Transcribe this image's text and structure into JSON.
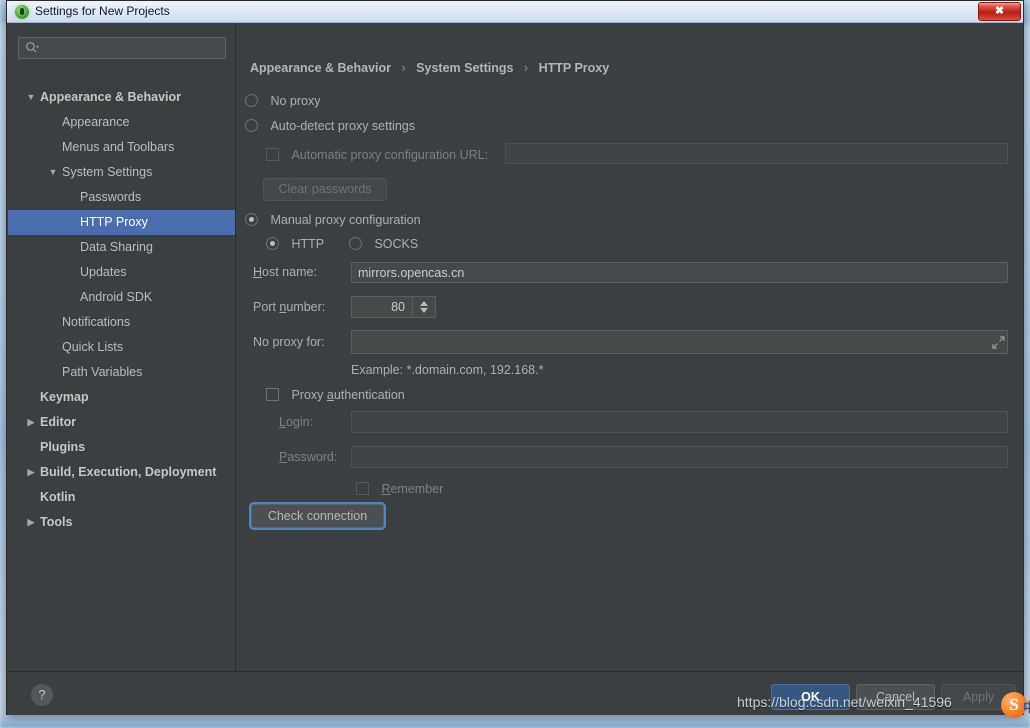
{
  "window": {
    "title": "Settings for New Projects",
    "app_icon": "android-studio-icon",
    "close_label": "✖"
  },
  "sidebar": {
    "search": {
      "value": "",
      "placeholder": "",
      "icon": "search-icon"
    },
    "tree": [
      {
        "label": "Appearance & Behavior",
        "level": 0,
        "bold": true,
        "arrow": "expanded",
        "selected": false
      },
      {
        "label": "Appearance",
        "level": 1,
        "bold": false,
        "arrow": "none",
        "selected": false
      },
      {
        "label": "Menus and Toolbars",
        "level": 1,
        "bold": false,
        "arrow": "none",
        "selected": false
      },
      {
        "label": "System Settings",
        "level": 1,
        "bold": false,
        "arrow": "expanded1",
        "selected": false
      },
      {
        "label": "Passwords",
        "level": 2,
        "bold": false,
        "arrow": "none",
        "selected": false
      },
      {
        "label": "HTTP Proxy",
        "level": 2,
        "bold": false,
        "arrow": "none",
        "selected": true
      },
      {
        "label": "Data Sharing",
        "level": 2,
        "bold": false,
        "arrow": "none",
        "selected": false
      },
      {
        "label": "Updates",
        "level": 2,
        "bold": false,
        "arrow": "none",
        "selected": false
      },
      {
        "label": "Android SDK",
        "level": 2,
        "bold": false,
        "arrow": "none",
        "selected": false
      },
      {
        "label": "Notifications",
        "level": 1,
        "bold": false,
        "arrow": "none",
        "selected": false
      },
      {
        "label": "Quick Lists",
        "level": 1,
        "bold": false,
        "arrow": "none",
        "selected": false
      },
      {
        "label": "Path Variables",
        "level": 1,
        "bold": false,
        "arrow": "none",
        "selected": false
      },
      {
        "label": "Keymap",
        "level": 0,
        "bold": true,
        "arrow": "none",
        "selected": false
      },
      {
        "label": "Editor",
        "level": 0,
        "bold": true,
        "arrow": "collapsed",
        "selected": false
      },
      {
        "label": "Plugins",
        "level": 0,
        "bold": true,
        "arrow": "none",
        "selected": false
      },
      {
        "label": "Build, Execution, Deployment",
        "level": 0,
        "bold": true,
        "arrow": "collapsed",
        "selected": false
      },
      {
        "label": "Kotlin",
        "level": 0,
        "bold": true,
        "arrow": "none",
        "selected": false
      },
      {
        "label": "Tools",
        "level": 0,
        "bold": true,
        "arrow": "collapsed",
        "selected": false
      }
    ]
  },
  "main": {
    "breadcrumb": {
      "part1": "Appearance & Behavior",
      "part2": "System Settings",
      "part3": "HTTP Proxy",
      "separator": "›"
    },
    "no_proxy": {
      "label": "No proxy",
      "checked": false
    },
    "auto_detect": {
      "label": "Auto-detect proxy settings",
      "checked": false
    },
    "auto_config_url": {
      "label": "Automatic proxy configuration URL:",
      "checked": false,
      "value": "",
      "placeholder": ""
    },
    "clear_passwords": {
      "label": "Clear passwords",
      "enabled": false
    },
    "manual_proxy": {
      "label": "Manual proxy configuration",
      "checked": true
    },
    "protocol_http": {
      "label": "HTTP",
      "checked": true
    },
    "protocol_socks": {
      "label": "SOCKS",
      "checked": false
    },
    "host_name": {
      "label": "Host name:",
      "value": "mirrors.opencas.cn",
      "placeholder": ""
    },
    "port_number": {
      "label": "Port number:",
      "value": "80",
      "spinner": "spinner-arrows"
    },
    "no_proxy_for": {
      "label": "No proxy for:",
      "value": "",
      "placeholder": "",
      "expand_icon": "expand-icon"
    },
    "example_hint": "Example: *.domain.com, 192.168.*",
    "proxy_auth": {
      "label": "Proxy authentication",
      "checked": false
    },
    "login": {
      "label": "Login:",
      "value": "",
      "placeholder": "",
      "enabled": false
    },
    "password": {
      "label": "Password:",
      "value": "",
      "placeholder": "",
      "enabled": false
    },
    "remember": {
      "label": "Remember",
      "checked": false,
      "enabled": false
    },
    "check_connection": {
      "label": "Check connection",
      "focused": true
    }
  },
  "footer": {
    "help_label": "?",
    "ok_label": "OK",
    "cancel_label": "Cancel",
    "apply_label": "Apply"
  },
  "watermark": {
    "text": "https://blog.csdn.net/weixin_41596",
    "logo": "sogou-logo",
    "logo_glyph": "S",
    "logo_char": "中"
  },
  "colors": {
    "panel_bg": "#3c3f41",
    "selection": "#4b6eaf",
    "accent_button": "#365880",
    "focus_ring": "#4a88c7",
    "text": "#a9b0b5",
    "text_dim": "#7b8084",
    "field_bg": "#45494a"
  }
}
